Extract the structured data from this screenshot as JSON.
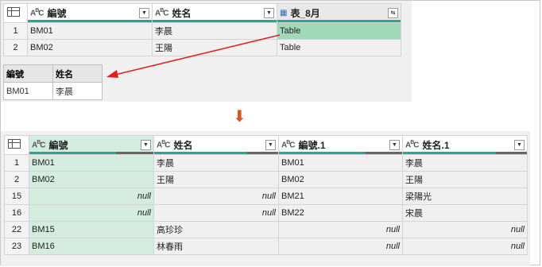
{
  "top": {
    "columns": [
      {
        "type_icon": "ABC",
        "label": "編號"
      },
      {
        "type_icon": "ABC",
        "label": "姓名"
      },
      {
        "type_icon": "table",
        "label": "表_8月"
      }
    ],
    "rows": [
      {
        "num": "1",
        "c1": "BM01",
        "c2": "李晨",
        "c3": "Table"
      },
      {
        "num": "2",
        "c1": "BM02",
        "c2": "王陽",
        "c3": "Table"
      }
    ]
  },
  "preview": {
    "headers": [
      "編號",
      "姓名"
    ],
    "rows": [
      [
        "BM01",
        "李晨"
      ]
    ]
  },
  "bottom": {
    "columns": [
      {
        "type_icon": "ABC",
        "label": "編號"
      },
      {
        "type_icon": "ABC",
        "label": "姓名"
      },
      {
        "type_icon": "ABC",
        "label": "編號.1"
      },
      {
        "type_icon": "ABC",
        "label": "姓名.1"
      }
    ],
    "rows": [
      {
        "num": "1",
        "c1": "BM01",
        "c2": "李晨",
        "c3": "BM01",
        "c4": "李晨"
      },
      {
        "num": "2",
        "c1": "BM02",
        "c2": "王陽",
        "c3": "BM02",
        "c4": "王陽"
      },
      {
        "num": "15",
        "c1": "null",
        "c2": "null",
        "c3": "BM21",
        "c4": "梁陽光"
      },
      {
        "num": "16",
        "c1": "null",
        "c2": "null",
        "c3": "BM22",
        "c4": "宋晨"
      },
      {
        "num": "22",
        "c1": "BM15",
        "c2": "高珍珍",
        "c3": "null",
        "c4": "null"
      },
      {
        "num": "23",
        "c1": "BM16",
        "c2": "林春雨",
        "c3": "null",
        "c4": "null"
      }
    ]
  },
  "colors": {
    "accent": "#27a58f",
    "arrow": "#d9571e",
    "red_arrow": "#e02020"
  }
}
